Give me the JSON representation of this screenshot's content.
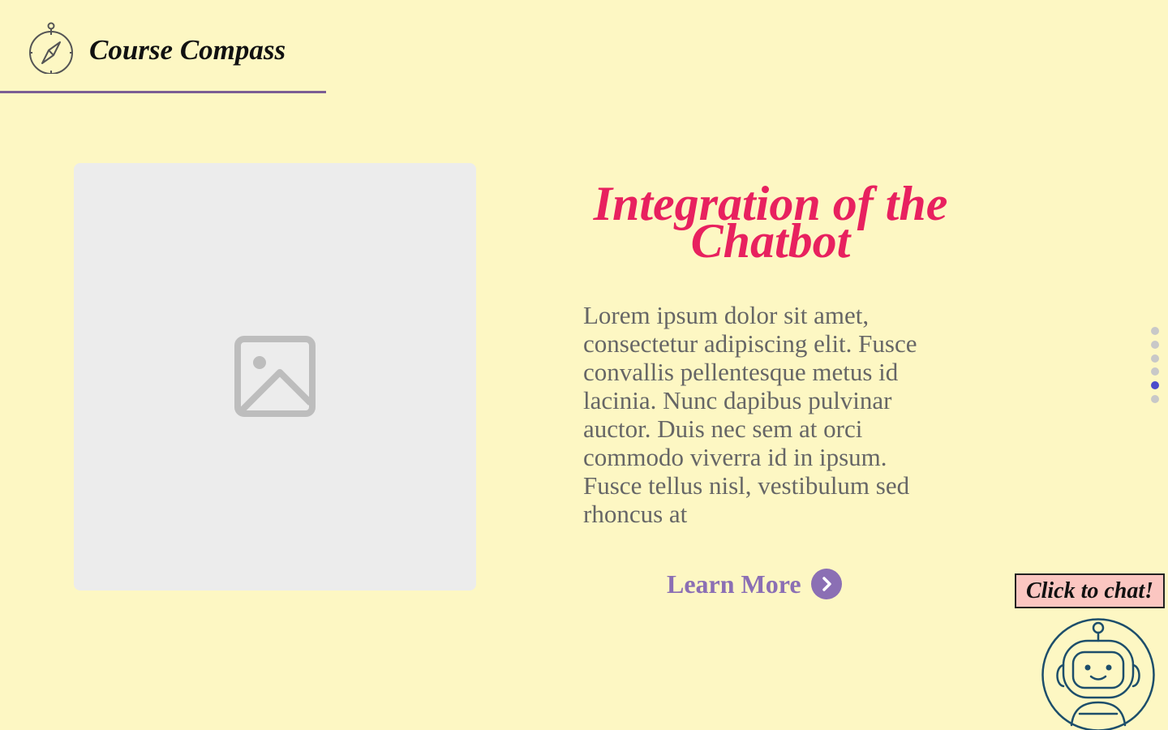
{
  "header": {
    "title": "Course Compass",
    "icon": "compass-icon"
  },
  "hero": {
    "image_icon": "image-placeholder-icon",
    "headline": "Integration of the Chatbot",
    "body": "Lorem ipsum dolor sit amet, consectetur adipiscing elit. Fusce convallis pellentesque metus id lacinia. Nunc dapibus pulvinar auctor. Duis nec sem at orci commodo viverra id in ipsum. Fusce tellus nisl, vestibulum sed rhoncus at",
    "cta_label": "Learn More",
    "cta_icon": "chevron-right-icon"
  },
  "pagination": {
    "total": 6,
    "active_index": 5
  },
  "chat": {
    "label": "Click to chat!",
    "avatar_icon": "robot-icon"
  },
  "colors": {
    "background": "#fdf7c3",
    "headline": "#e8215f",
    "accent": "#8b6fb4",
    "body_text": "#666666",
    "header_rule": "#7b5e94",
    "active_dot": "#4c4ccb",
    "inactive_dot": "#c8c8c8",
    "chat_button_bg": "#fbc6c1",
    "robot_stroke": "#1d4e6b"
  }
}
